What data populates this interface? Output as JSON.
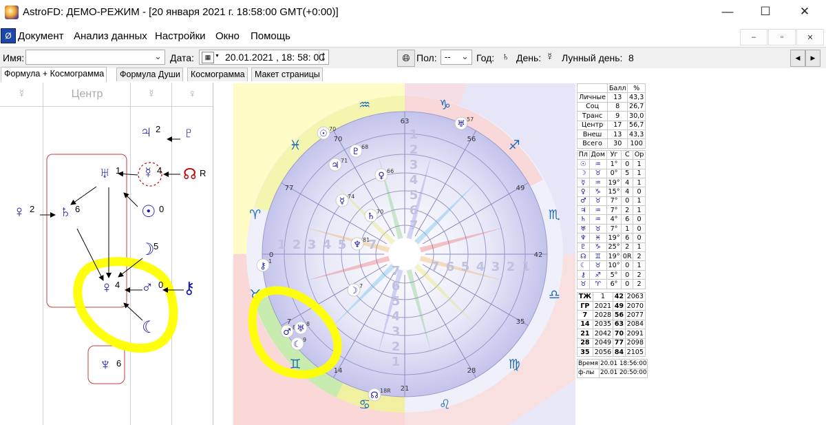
{
  "window": {
    "title": "AstroFD: ДЕМО-РЕЖИМ - [20 января 2021 г. 18:58:00 GMT(+0:00)]",
    "min_glyph": "—",
    "max_glyph": "☐",
    "close_glyph": "✕"
  },
  "menu": {
    "items": [
      "Документ",
      "Анализ данных",
      "Настройки",
      "Окно",
      "Помощь"
    ],
    "mdi_min": "–",
    "mdi_restore": "▫",
    "mdi_close": "✕"
  },
  "toolbar": {
    "name_label": "Имя:",
    "name_value": "",
    "date_label": "Дата:",
    "date_value": "20.01.2021 , 18: 58: 00",
    "gender_label": "Пол:",
    "gender_value": "--",
    "year_label": "Год:",
    "year_symbol": "♄",
    "day_label": "День:",
    "day_symbol": "☿",
    "lunar_day_label": "Лунный день:",
    "lunar_day_value": "8",
    "prev": "◀",
    "next": "▶"
  },
  "tabs": [
    {
      "label": "Формула + Космограмма",
      "active": true
    },
    {
      "label": "Формула Души",
      "active": false
    },
    {
      "label": "Космограмма",
      "active": false
    },
    {
      "label": "Макет страницы",
      "active": false
    }
  ],
  "formula": {
    "col_heads": [
      "☿",
      "Центр",
      "☿",
      "♀"
    ],
    "nodes": {
      "jupiter": {
        "glyph": "♃",
        "num": "2"
      },
      "pluto_top": {
        "glyph": "♇",
        "num": ""
      },
      "uranus": {
        "glyph": "♅",
        "num": "1"
      },
      "mercury": {
        "glyph": "☿",
        "num": "4"
      },
      "node": {
        "glyph": "☊",
        "num": "R"
      },
      "venus_left": {
        "glyph": "♀",
        "num": "2"
      },
      "saturn": {
        "glyph": "♄",
        "num": "6"
      },
      "sun": {
        "glyph": "☉",
        "num": "0"
      },
      "moon": {
        "glyph": "☽",
        "num": "5"
      },
      "venus": {
        "glyph": "♀",
        "num": "4"
      },
      "mars": {
        "glyph": "♂",
        "num": "0"
      },
      "chiron": {
        "glyph": "⚷",
        "num": ""
      },
      "lilith": {
        "glyph": "☾",
        "num": ""
      },
      "neptune": {
        "glyph": "♆",
        "num": "6"
      }
    }
  },
  "cosmogram": {
    "zodiac_symbols": [
      "♑",
      "♐",
      "♏",
      "♎",
      "♍",
      "♌",
      "♋",
      "♊",
      "♉",
      "♈",
      "♓",
      "♒"
    ],
    "degree_labels": [
      "63",
      "56",
      "49",
      "42",
      "35",
      "28",
      "21",
      "14",
      "7",
      "0",
      "77",
      "70"
    ],
    "inner_numbers": [
      "1",
      "2",
      "3",
      "4",
      "5",
      "6",
      "7"
    ],
    "planets": [
      {
        "glyph": "☉",
        "label": "70"
      },
      {
        "glyph": "♇",
        "label": "68"
      },
      {
        "glyph": "♃",
        "label": "71"
      },
      {
        "glyph": "♀",
        "label": "66"
      },
      {
        "glyph": "☿",
        "label": "74"
      },
      {
        "glyph": "♄",
        "label": "70"
      },
      {
        "glyph": "♆",
        "label": "81"
      },
      {
        "glyph": "♅",
        "label": "57"
      },
      {
        "glyph": "⚷",
        "label": "1"
      },
      {
        "glyph": "☽",
        "label": "7"
      },
      {
        "glyph": "♂",
        "label": "8"
      },
      {
        "glyph": "♅",
        "label": "8"
      },
      {
        "glyph": "☾",
        "label": "9"
      },
      {
        "glyph": "☊",
        "label": "18R"
      }
    ]
  },
  "table": {
    "score_header": [
      "",
      "Балл",
      "%"
    ],
    "score_rows": [
      [
        "Личные",
        "13",
        "43,3"
      ],
      [
        "Соц",
        "8",
        "26,7"
      ],
      [
        "Транс",
        "9",
        "30,0"
      ],
      [
        "Центр",
        "17",
        "56,7"
      ],
      [
        "Внеш",
        "13",
        "43,3"
      ],
      [
        "Всего",
        "30",
        "100"
      ]
    ],
    "planet_header": [
      "Пл",
      "Дом",
      "Уг",
      "С",
      "Ор"
    ],
    "planet_rows": [
      [
        "☉",
        "♒",
        "1°",
        "0",
        "1"
      ],
      [
        "☽",
        "♉",
        "0°",
        "5",
        "1"
      ],
      [
        "☿",
        "♒",
        "19°",
        "4",
        "1"
      ],
      [
        "♀",
        "♑",
        "15°",
        "4",
        "0"
      ],
      [
        "♂",
        "♉",
        "7°",
        "0",
        "1"
      ],
      [
        "♃",
        "♒",
        "7°",
        "2",
        "1"
      ],
      [
        "♄",
        "♒",
        "4°",
        "6",
        "0"
      ],
      [
        "♅",
        "♉",
        "7°",
        "1",
        "0"
      ],
      [
        "♆",
        "♓",
        "19°",
        "6",
        "0"
      ],
      [
        "♇",
        "♑",
        "25°",
        "2",
        "1"
      ],
      [
        "☊",
        "♊",
        "19°",
        "0R",
        "2"
      ],
      [
        "☾",
        "♉",
        "10°",
        "0",
        "1"
      ],
      [
        "⚷",
        "♐",
        "5°",
        "0",
        "2"
      ],
      [
        "♉",
        "♈",
        "6°",
        "0",
        "2"
      ]
    ],
    "cycle_rows": [
      [
        "ТЖ",
        "1",
        "42",
        "2063"
      ],
      [
        "ГР",
        "2021",
        "49",
        "2070"
      ],
      [
        "7",
        "2028",
        "56",
        "2077"
      ],
      [
        "14",
        "2035",
        "63",
        "2084"
      ],
      [
        "21",
        "2042",
        "70",
        "2091"
      ],
      [
        "28",
        "2049",
        "77",
        "2098"
      ],
      [
        "35",
        "2056",
        "84",
        "2105"
      ]
    ],
    "timestamps": [
      [
        "Время",
        "20.01 18:56:00"
      ],
      [
        "ф-лы",
        "20.01 20:50:00"
      ]
    ]
  },
  "colors": {
    "planet_blue": "#1a1aa8",
    "node_red": "#c00000",
    "highlight_yellow": "#ffff00",
    "box_red": "#c04040"
  }
}
